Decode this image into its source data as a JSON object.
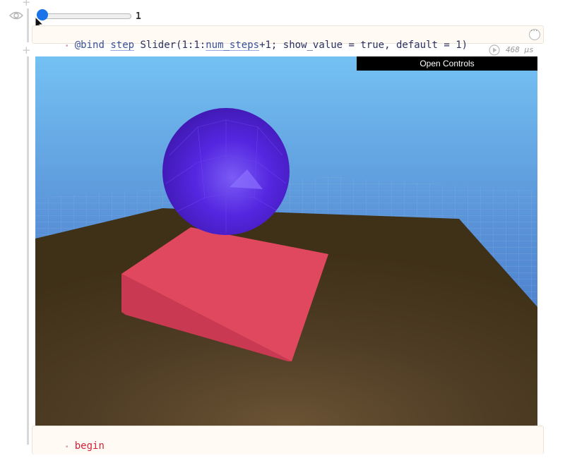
{
  "slider": {
    "value": "1",
    "fraction": 0.0
  },
  "cell1": {
    "code_bind": "@bind",
    "code_var": "step",
    "code_fn": "Slider(1:1:",
    "code_arg": "num_steps",
    "code_rest": "+1; show_value = true, default = 1)"
  },
  "runtime": {
    "label": "468 μs"
  },
  "scene": {
    "controls_button": "Open Controls"
  },
  "cell2": {
    "line1": "begin"
  },
  "colors": {
    "sky_top": "#74c1f3",
    "sky_bottom": "#3f6fc1",
    "floor": "#4b3a22",
    "sphere": "#5525e0",
    "ramp": "#e0485f",
    "slider_knob": "#1a73e8"
  }
}
